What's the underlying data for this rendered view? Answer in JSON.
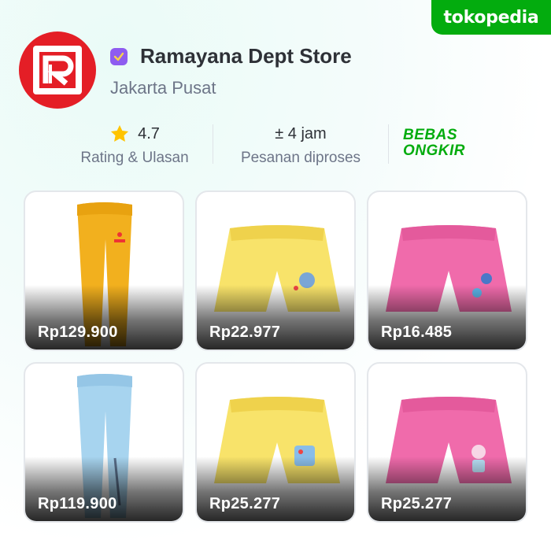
{
  "brand": {
    "name": "tokopedia",
    "color": "#03ac0e"
  },
  "store": {
    "name": "Ramayana Dept Store",
    "location": "Jakarta Pusat",
    "logo_icon": "ramayana-logo",
    "badge_icon": "official-store-badge-icon",
    "logo_color": "#e41e26",
    "badge_color": "#8e5cf0"
  },
  "stats": {
    "rating": {
      "value": "4.7",
      "label": "Rating & Ulasan",
      "icon": "star-icon"
    },
    "process": {
      "value": "± 4 jam",
      "label": "Pesanan diproses"
    },
    "shipping": {
      "line1": "BEBAS",
      "line2": "ONGKIR"
    }
  },
  "products": [
    {
      "price": "Rp129.900",
      "item": "long-pants",
      "color": "#f2b01e"
    },
    {
      "price": "Rp22.977",
      "item": "shorts",
      "color": "#f8e36a"
    },
    {
      "price": "Rp16.485",
      "item": "shorts",
      "color": "#f06bab"
    },
    {
      "price": "Rp119.900",
      "item": "long-pants",
      "color": "#a7d4ef"
    },
    {
      "price": "Rp25.277",
      "item": "shorts",
      "color": "#f8e36a"
    },
    {
      "price": "Rp25.277",
      "item": "shorts",
      "color": "#f06bab"
    }
  ]
}
